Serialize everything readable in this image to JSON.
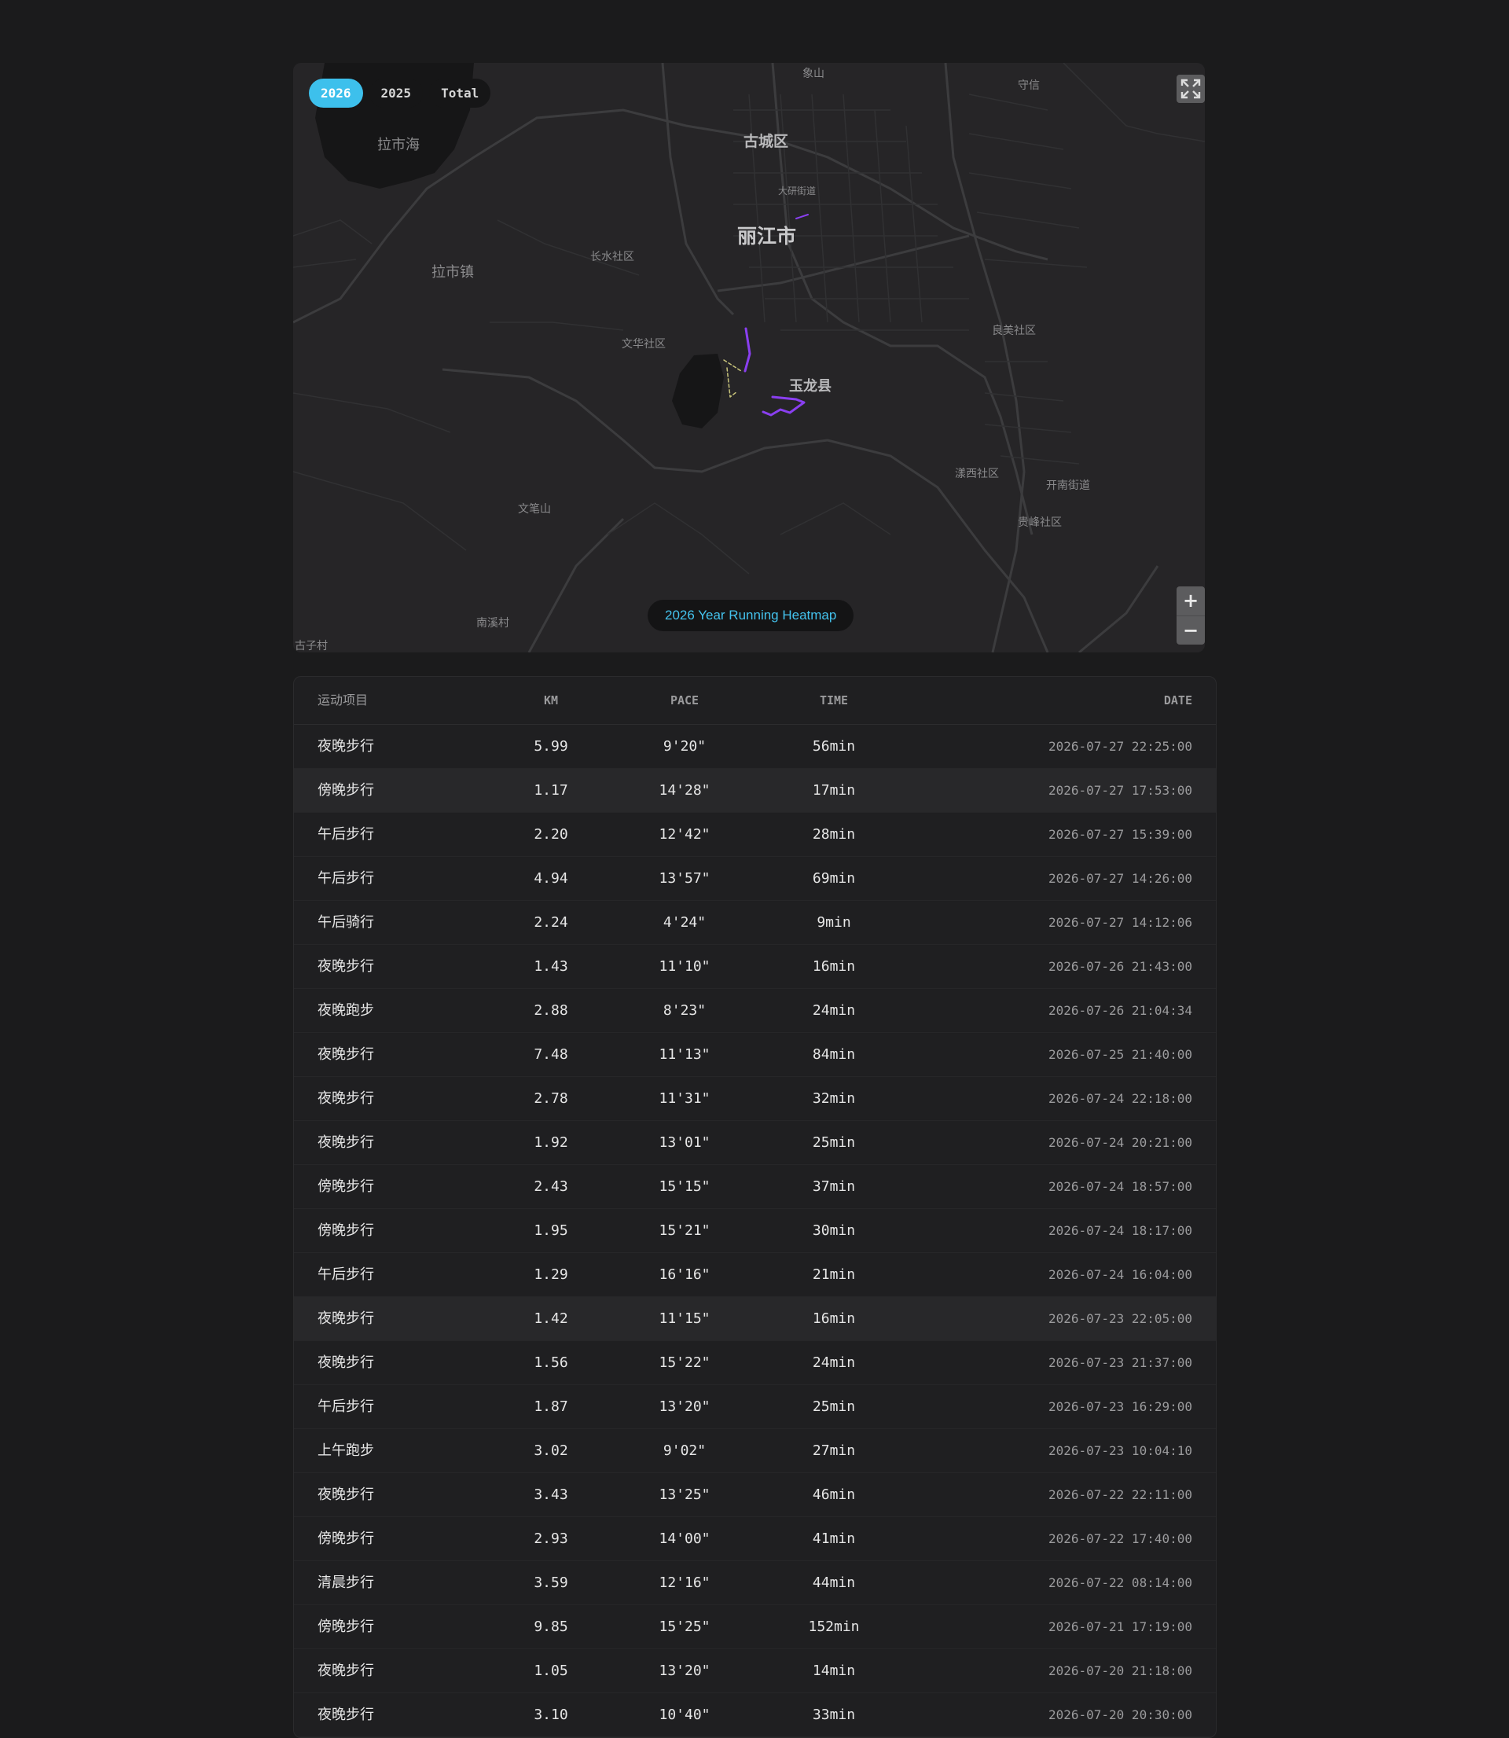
{
  "map": {
    "year_tabs": [
      {
        "label": "2026",
        "active": true
      },
      {
        "label": "2025",
        "active": false
      },
      {
        "label": "Total",
        "active": false
      }
    ],
    "caption": "2026 Year Running Heatmap",
    "zoom_in": "+",
    "zoom_out": "−",
    "fullscreen_icon": "fullscreen-icon",
    "route_color": "#8a3ff0",
    "accent": "#3dc0ec",
    "labels": {
      "xiangshan": "象山",
      "shouxin": "守信",
      "lashihai": "拉市海",
      "guchengqu": "古城区",
      "dayan": "大研街道",
      "lijiang": "丽江市",
      "changshui": "长水社区",
      "lashizhen": "拉市镇",
      "wenhua": "文华社区",
      "liangmei": "良美社区",
      "yulong": "玉龙县",
      "yangxi": "漾西社区",
      "kainan": "开南街道",
      "guifeng": "贵峰社区",
      "wenbishan": "文笔山",
      "nanxicun": "南溪村",
      "zizicun": "古子村"
    }
  },
  "table": {
    "headers": {
      "name": "运动项目",
      "km": "KM",
      "pace": "PACE",
      "time": "TIME",
      "date": "DATE"
    },
    "rows": [
      {
        "name": "夜晚步行",
        "km": "5.99",
        "pace": "9'20\"",
        "time": "56min",
        "date": "2026-07-27 22:25:00"
      },
      {
        "name": "傍晚步行",
        "km": "1.17",
        "pace": "14'28\"",
        "time": "17min",
        "date": "2026-07-27 17:53:00"
      },
      {
        "name": "午后步行",
        "km": "2.20",
        "pace": "12'42\"",
        "time": "28min",
        "date": "2026-07-27 15:39:00"
      },
      {
        "name": "午后步行",
        "km": "4.94",
        "pace": "13'57\"",
        "time": "69min",
        "date": "2026-07-27 14:26:00"
      },
      {
        "name": "午后骑行",
        "km": "2.24",
        "pace": "4'24\"",
        "time": "9min",
        "date": "2026-07-27 14:12:06"
      },
      {
        "name": "夜晚步行",
        "km": "1.43",
        "pace": "11'10\"",
        "time": "16min",
        "date": "2026-07-26 21:43:00"
      },
      {
        "name": "夜晚跑步",
        "km": "2.88",
        "pace": "8'23\"",
        "time": "24min",
        "date": "2026-07-26 21:04:34"
      },
      {
        "name": "夜晚步行",
        "km": "7.48",
        "pace": "11'13\"",
        "time": "84min",
        "date": "2026-07-25 21:40:00"
      },
      {
        "name": "夜晚步行",
        "km": "2.78",
        "pace": "11'31\"",
        "time": "32min",
        "date": "2026-07-24 22:18:00"
      },
      {
        "name": "夜晚步行",
        "km": "1.92",
        "pace": "13'01\"",
        "time": "25min",
        "date": "2026-07-24 20:21:00"
      },
      {
        "name": "傍晚步行",
        "km": "2.43",
        "pace": "15'15\"",
        "time": "37min",
        "date": "2026-07-24 18:57:00"
      },
      {
        "name": "傍晚步行",
        "km": "1.95",
        "pace": "15'21\"",
        "time": "30min",
        "date": "2026-07-24 18:17:00"
      },
      {
        "name": "午后步行",
        "km": "1.29",
        "pace": "16'16\"",
        "time": "21min",
        "date": "2026-07-24 16:04:00"
      },
      {
        "name": "夜晚步行",
        "km": "1.42",
        "pace": "11'15\"",
        "time": "16min",
        "date": "2026-07-23 22:05:00"
      },
      {
        "name": "夜晚步行",
        "km": "1.56",
        "pace": "15'22\"",
        "time": "24min",
        "date": "2026-07-23 21:37:00"
      },
      {
        "name": "午后步行",
        "km": "1.87",
        "pace": "13'20\"",
        "time": "25min",
        "date": "2026-07-23 16:29:00"
      },
      {
        "name": "上午跑步",
        "km": "3.02",
        "pace": "9'02\"",
        "time": "27min",
        "date": "2026-07-23 10:04:10"
      },
      {
        "name": "夜晚步行",
        "km": "3.43",
        "pace": "13'25\"",
        "time": "46min",
        "date": "2026-07-22 22:11:00"
      },
      {
        "name": "傍晚步行",
        "km": "2.93",
        "pace": "14'00\"",
        "time": "41min",
        "date": "2026-07-22 17:40:00"
      },
      {
        "name": "清晨步行",
        "km": "3.59",
        "pace": "12'16\"",
        "time": "44min",
        "date": "2026-07-22 08:14:00"
      },
      {
        "name": "傍晚步行",
        "km": "9.85",
        "pace": "15'25\"",
        "time": "152min",
        "date": "2026-07-21 17:19:00"
      },
      {
        "name": "夜晚步行",
        "km": "1.05",
        "pace": "13'20\"",
        "time": "14min",
        "date": "2026-07-20 21:18:00"
      },
      {
        "name": "夜晚步行",
        "km": "3.10",
        "pace": "10'40\"",
        "time": "33min",
        "date": "2026-07-20 20:30:00"
      }
    ],
    "highlighted_rows": [
      1,
      13
    ]
  }
}
